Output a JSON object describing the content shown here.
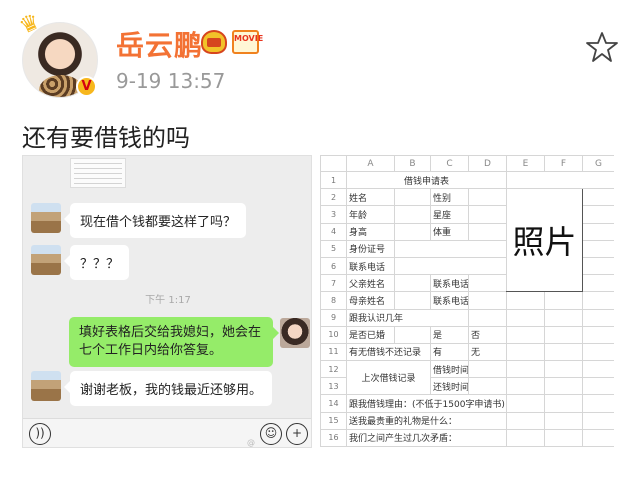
{
  "post": {
    "username": "岳云鹏",
    "timestamp": "9-19 13:57",
    "text": "还有要借钱的吗",
    "badges": {
      "vip": "V",
      "movie": "MOVIE"
    },
    "icons": [
      "crown-icon",
      "level-icon",
      "movie-badge-icon",
      "star-icon"
    ]
  },
  "chat": {
    "messages": [
      {
        "from": "other",
        "text": "现在借个钱都要这样了吗？"
      },
      {
        "from": "other",
        "text": "？？？"
      },
      {
        "from": "self",
        "text": "填好表格后交给我媳妇，她会在七个工作日内给你答复。"
      },
      {
        "from": "other",
        "text": "谢谢老板，我的钱最近还够用。"
      }
    ],
    "time_divider": "下午 1:17",
    "icons": [
      "voice-icon",
      "emoji-icon",
      "plus-icon"
    ]
  },
  "sheet": {
    "columns": [
      "A",
      "B",
      "C",
      "D",
      "E",
      "F",
      "G"
    ],
    "row_numbers": [
      "1",
      "2",
      "3",
      "4",
      "5",
      "6",
      "7",
      "8",
      "9",
      "10",
      "11",
      "12",
      "13",
      "14",
      "15",
      "16"
    ],
    "title": "借钱申请表",
    "name": "姓名",
    "gender": "性别",
    "age": "年龄",
    "zodiac": "星座",
    "height": "身高",
    "weight": "体重",
    "id_number": "身份证号",
    "phone": "联系电话",
    "father_name": "父亲姓名",
    "mother_name": "母亲姓名",
    "contact_phone": "联系电话",
    "years_known": "跟我认识几年",
    "married": "是否已婚",
    "yes": "是",
    "no": "否",
    "bad_record": "有无借钱不还记录",
    "have": "有",
    "none": "无",
    "last_loan": "上次借钱记录",
    "borrow_time": "借钱时间",
    "repay_time": "还钱时间",
    "reason": "跟我借钱理由：(不低于1500字申请书)",
    "gift": "送我最贵重的礼物是什么：",
    "conflicts": "我们之间产生过几次矛盾：",
    "photo": "照片"
  }
}
